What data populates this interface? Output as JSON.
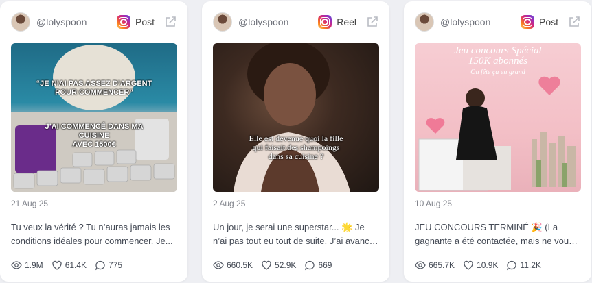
{
  "cards": [
    {
      "handle": "@lolyspoon",
      "type_label": "Post",
      "overlay_top": "“JE N’AI PAS ASSEZ D’ARGENT\nPOUR COMMENCER”",
      "overlay_bottom": "J’AI COMMENCÉ DANS MA CUISINE\nAVEC 1500€",
      "date": "21 Aug 25",
      "text": "Tu veux la vérité ? Tu n’auras jamais les conditions idéales pour commencer. Je...",
      "views": "1.9M",
      "likes": "61.4K",
      "comments": "775"
    },
    {
      "handle": "@lolyspoon",
      "type_label": "Reel",
      "overlay": "Elle est devenue quoi la fille\nqui faisait des shampoings\ndans sa cuisine ?",
      "date": "2 Aug 25",
      "text": "Un jour, je serai une superstar... 🌟 Je n’ai pas tout eu tout de suite. J’ai avancé pa...",
      "views": "660.5K",
      "likes": "52.9K",
      "comments": "669"
    },
    {
      "handle": "@lolyspoon",
      "type_label": "Post",
      "overlay_title": "Jeu concours Spécial\n150K abonnés",
      "overlay_sub": "On fête ça en grand",
      "date": "10 Aug 25",
      "text": "JEU CONCOURS TERMINÉ 🎉 (La gagnante a été contactée, mais ne vous inquiétez...",
      "views": "665.7K",
      "likes": "10.9K",
      "comments": "11.2K"
    }
  ]
}
